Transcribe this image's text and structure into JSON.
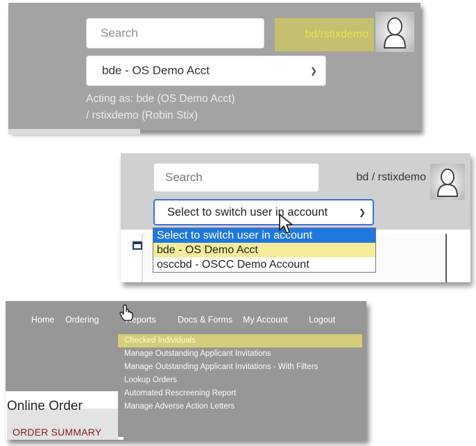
{
  "panel1": {
    "search_placeholder": "Search",
    "user_label": "bd/rstixdemo",
    "account_select_value": "bde - OS Demo Acct",
    "acting_as_line1": "Acting as: bde (OS Demo Acct)",
    "acting_as_line2": "/ rstixdemo (Robin Stix)"
  },
  "panel2": {
    "search_placeholder": "Search",
    "user_label": "bd / rstixdemo",
    "user_select_value": "Select to switch user in account",
    "dropdown_options": [
      "Select to switch user in account",
      "bde - OS Demo Acct",
      "osccbd - OSCC Demo Account"
    ]
  },
  "panel3": {
    "nav": {
      "home": "Home",
      "ordering": "Ordering",
      "reports": "Reports",
      "docs_forms": "Docs & Forms",
      "my_account": "My Account",
      "logout": "Logout"
    },
    "reports_menu": [
      "Checked Individuals",
      "Manage Outstanding Applicant Invitations",
      "Manage Outstanding Applicant Invitations - With Filters",
      "Lookup Orders",
      "Automated Rescreening Report",
      "Manage Adverse Action Letters"
    ],
    "page_title": "Online Order",
    "order_summary": "ORDER SUMMARY"
  },
  "colors": {
    "highlight_yellow": "#d3cd7a",
    "select_blue": "#1f78e0",
    "panel_gray": "#a3a3a3"
  }
}
